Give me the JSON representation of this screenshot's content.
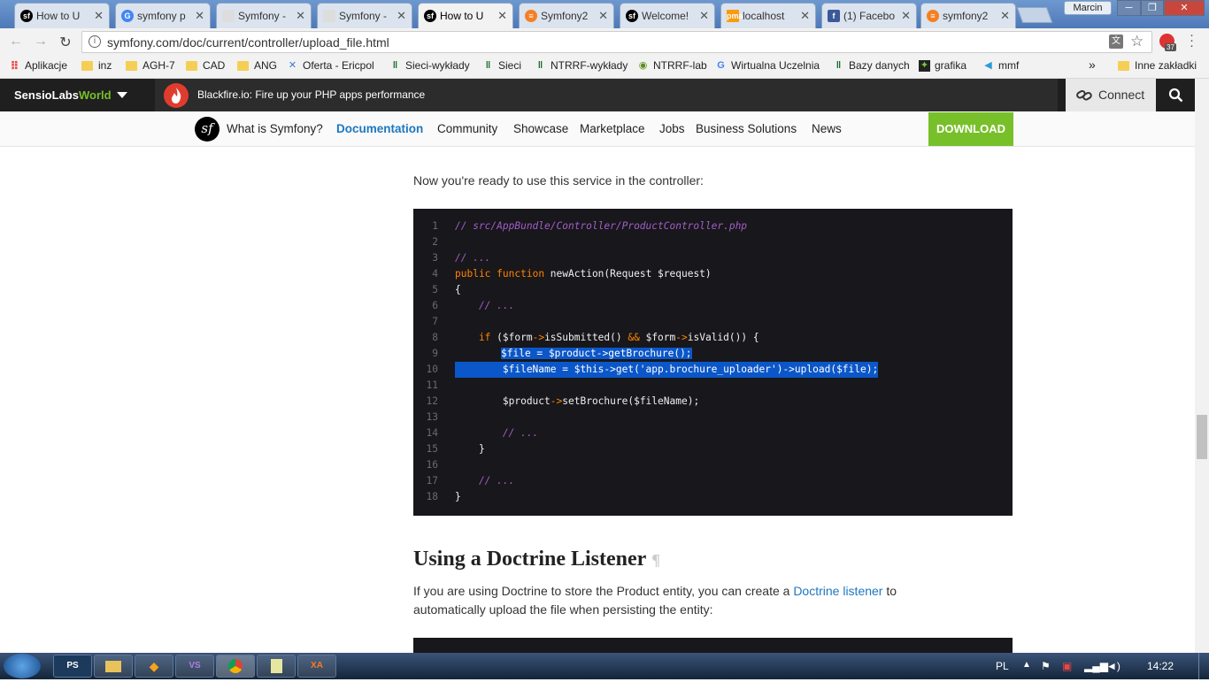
{
  "tabs": [
    {
      "label": "How to U",
      "icon": "symfony-icon"
    },
    {
      "label": "symfony p",
      "icon": "google-icon"
    },
    {
      "label": "Symfony -",
      "icon": "page-icon"
    },
    {
      "label": "Symfony -",
      "icon": "page-icon"
    },
    {
      "label": "How to U",
      "icon": "symfony-icon"
    },
    {
      "label": "Symfony2",
      "icon": "stack-overflow-icon"
    },
    {
      "label": "Welcome!",
      "icon": "symfony-icon"
    },
    {
      "label": "localhost",
      "icon": "phpmyadmin-icon"
    },
    {
      "label": "(1) Facebo",
      "icon": "facebook-icon"
    },
    {
      "label": "symfony2",
      "icon": "stack-overflow-icon"
    }
  ],
  "window": {
    "user": "Marcin"
  },
  "address": {
    "url": "symfony.com/doc/current/controller/upload_file.html",
    "badge": "37"
  },
  "bookmarks": [
    {
      "label": "Aplikacje"
    },
    {
      "label": "inz"
    },
    {
      "label": "AGH-7"
    },
    {
      "label": "CAD"
    },
    {
      "label": "ANG"
    },
    {
      "label": "Oferta - Ericpol"
    },
    {
      "label": "Sieci-wykłady"
    },
    {
      "label": "Sieci"
    },
    {
      "label": "NTRRF-wykłady"
    },
    {
      "label": "NTRRF-lab"
    },
    {
      "label": "Wirtualna Uczelnia"
    },
    {
      "label": "Bazy danych"
    },
    {
      "label": "grafika"
    },
    {
      "label": "mmf"
    },
    {
      "label": "»"
    },
    {
      "label": "Inne zakładki"
    }
  ],
  "topbar": {
    "brand_a": "SensioLabs",
    "brand_b": "World",
    "promo": "Blackfire.io: Fire up your PHP apps performance",
    "connect": "Connect"
  },
  "nav": {
    "logo": "sf",
    "items": [
      "What is Symfony?",
      "Documentation",
      "Community",
      "Showcase",
      "Marketplace",
      "Jobs",
      "Business Solutions",
      "News"
    ],
    "download": "DOWNLOAD"
  },
  "content": {
    "intro": "Now you're ready to use this service in the controller:",
    "line_numbers": [
      "1",
      "2",
      "3",
      "4",
      "5",
      "6",
      "7",
      "8",
      "9",
      "10",
      "11",
      "12",
      "13",
      "14",
      "15",
      "16",
      "17",
      "18"
    ],
    "code": {
      "l1": "// src/AppBundle/Controller/ProductController.php",
      "l3": "// ...",
      "l4_kw1": "public",
      "l4_kw2": "function",
      "l4_rest": " newAction(Request $request)",
      "l5": "{",
      "l6": "    // ...",
      "l8_kw": "    if",
      "l8_a": " ($form",
      "l8_op1": "->",
      "l8_b": "isSubmitted() ",
      "l8_op2": "&&",
      "l8_c": " $form",
      "l8_op3": "->",
      "l8_d": "isValid()) {",
      "l9": "$file = $product->getBrochure();",
      "l10": "        $fileName = $this->get('app.brochure_uploader')->upload($file);",
      "l12_a": "        $product",
      "l12_op": "->",
      "l12_b": "setBrochure($fileName);",
      "l14": "        // ...",
      "l15": "    }",
      "l17": "    // ...",
      "l18": "}"
    },
    "heading": "Using a Doctrine Listener",
    "pilcrow": "¶",
    "para_a": "If you are using Doctrine to store the Product entity, you can create a ",
    "para_link": "Doctrine listener",
    "para_b": " to automatically upload the file when persisting the entity:"
  },
  "taskbar": {
    "apps": [
      "PS",
      "",
      "",
      "VS",
      "",
      "",
      "XA"
    ],
    "lang": "PL",
    "time": "14:22"
  }
}
